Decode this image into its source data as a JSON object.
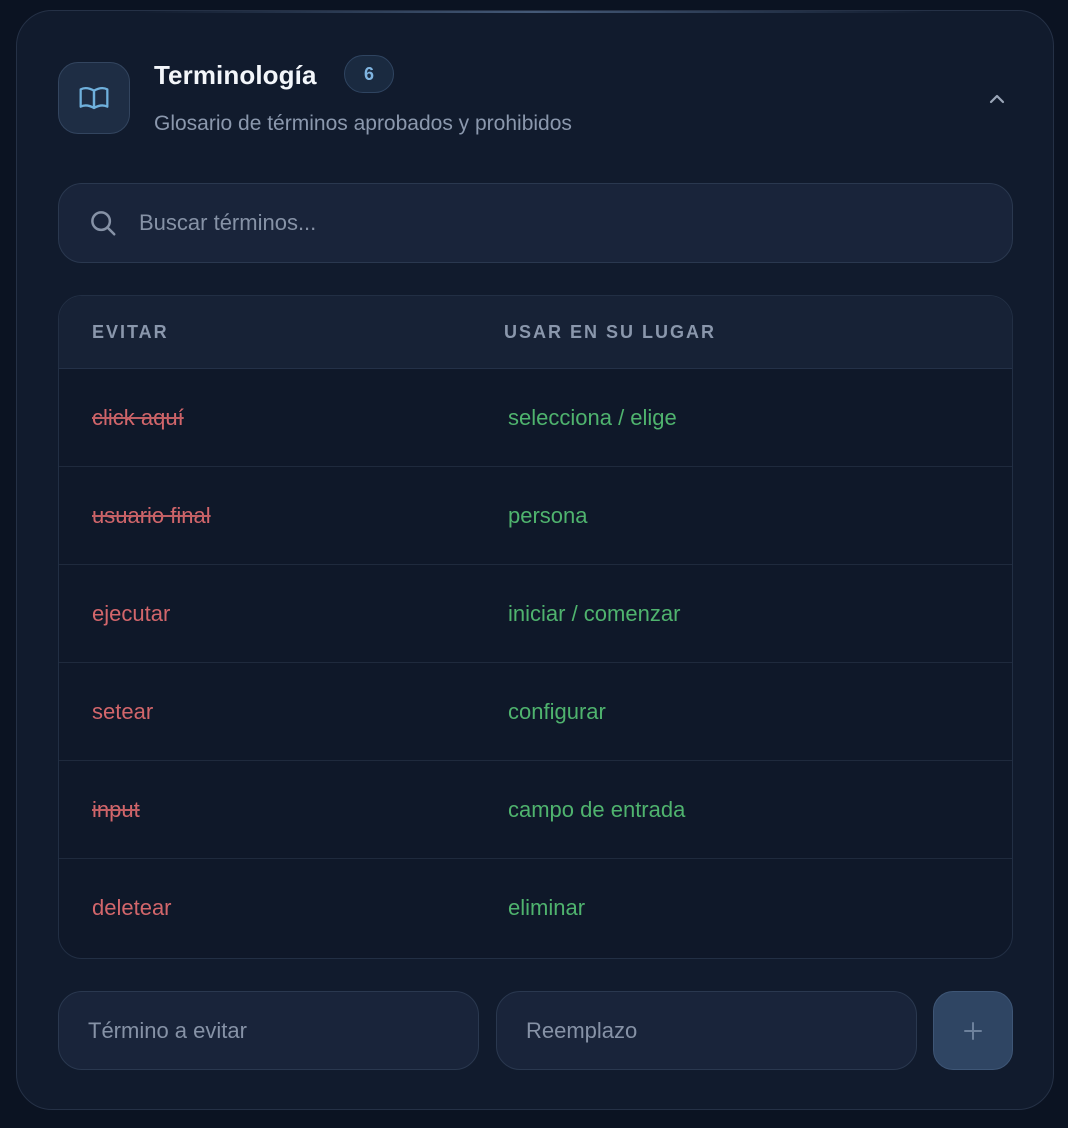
{
  "header": {
    "icon": "book-open-icon",
    "title": "Terminología",
    "count": "6",
    "subtitle": "Glosario de términos aprobados y prohibidos",
    "collapse_icon": "chevron-up-icon"
  },
  "search": {
    "icon": "search-icon",
    "placeholder": "Buscar términos..."
  },
  "table": {
    "columns": [
      "EVITAR",
      "USAR EN SU LUGAR"
    ],
    "rows": [
      {
        "avoid": "click aquí",
        "use": "selecciona / elige"
      },
      {
        "avoid": "usuario final",
        "use": "persona"
      },
      {
        "avoid": "ejecutar",
        "use": "iniciar / comenzar"
      },
      {
        "avoid": "setear",
        "use": "configurar"
      },
      {
        "avoid": "input",
        "use": "campo de entrada"
      },
      {
        "avoid": "deletear",
        "use": "eliminar"
      }
    ]
  },
  "form": {
    "avoid_placeholder": "Término a evitar",
    "replacement_placeholder": "Reemplazo",
    "add_icon": "plus-icon"
  },
  "colors": {
    "accent": "#7fb4e0",
    "avoid": "#d2666b",
    "use": "#4fb36e"
  }
}
